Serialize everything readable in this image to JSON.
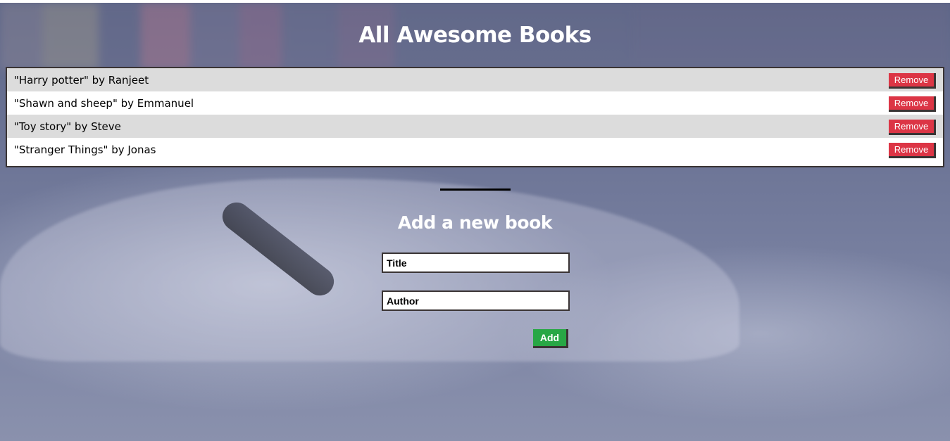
{
  "page": {
    "title": "All Awesome Books"
  },
  "books": [
    {
      "text": "\"Harry potter\" by Ranjeet",
      "remove_label": "Remove"
    },
    {
      "text": "\"Shawn and sheep\" by Emmanuel",
      "remove_label": "Remove"
    },
    {
      "text": "\"Toy story\" by Steve",
      "remove_label": "Remove"
    },
    {
      "text": "\"Stranger Things\" by Jonas",
      "remove_label": "Remove"
    }
  ],
  "form": {
    "title": "Add a new book",
    "title_input": {
      "value": "",
      "placeholder": "Title"
    },
    "author_input": {
      "value": "",
      "placeholder": "Author"
    },
    "add_label": "Add"
  },
  "colors": {
    "remove_button": "#dc3545",
    "add_button": "#28a745",
    "row_shade": "#dcdcdc",
    "border": "#3a3434"
  }
}
